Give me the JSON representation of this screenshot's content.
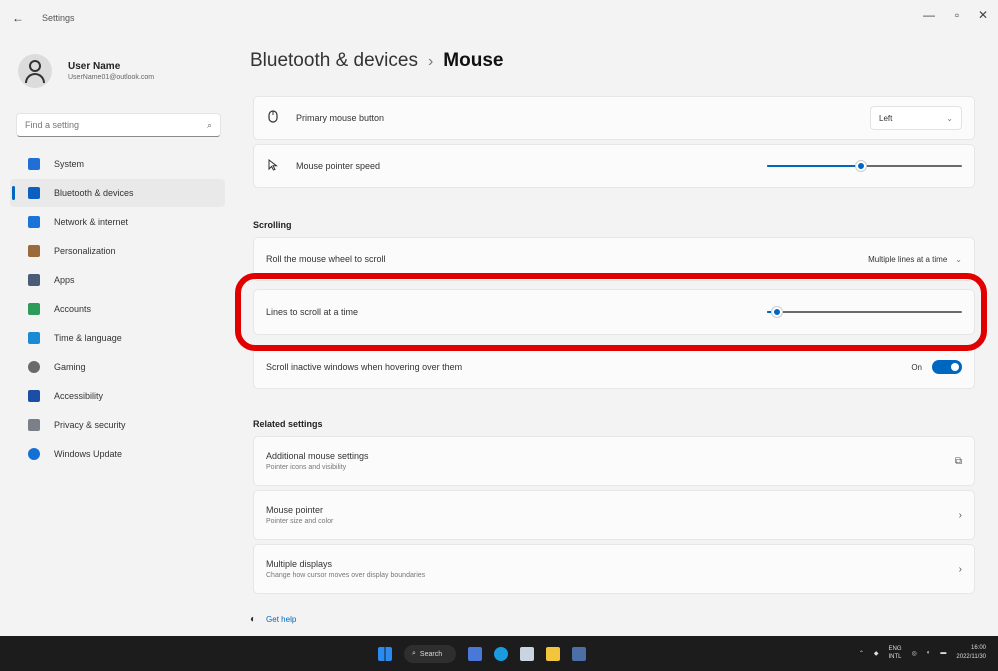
{
  "window": {
    "back_glyph": "←",
    "title": "Settings",
    "minimize_glyph": "—",
    "maximize_glyph": "▫",
    "close_glyph": "✕"
  },
  "user": {
    "name": "User Name",
    "email": "UserName01@outlook.com"
  },
  "search": {
    "placeholder": "Find a setting",
    "icon": "search-icon"
  },
  "nav": [
    {
      "label": "System",
      "icon": "system-icon",
      "color": "#1f6fd6",
      "active": false
    },
    {
      "label": "Bluetooth & devices",
      "icon": "bluetooth-icon",
      "color": "#0a5fc0",
      "active": true
    },
    {
      "label": "Network & internet",
      "icon": "network-icon",
      "color": "#1a73d9",
      "active": false
    },
    {
      "label": "Personalization",
      "icon": "brush-icon",
      "color": "#9a6a3a",
      "active": false
    },
    {
      "label": "Apps",
      "icon": "apps-icon",
      "color": "#4a5c78",
      "active": false
    },
    {
      "label": "Accounts",
      "icon": "accounts-icon",
      "color": "#2d9c5a",
      "active": false
    },
    {
      "label": "Time & language",
      "icon": "time-language-icon",
      "color": "#1a8ad4",
      "active": false
    },
    {
      "label": "Gaming",
      "icon": "gaming-icon",
      "color": "#6a6a6a",
      "active": false
    },
    {
      "label": "Accessibility",
      "icon": "accessibility-icon",
      "color": "#1b4fa6",
      "active": false
    },
    {
      "label": "Privacy & security",
      "icon": "shield-icon",
      "color": "#7a7f88",
      "active": false
    },
    {
      "label": "Windows Update",
      "icon": "windows-update-icon",
      "color": "#1570d6",
      "active": false
    }
  ],
  "breadcrumb": {
    "parent": "Bluetooth & devices",
    "separator": "›",
    "current": "Mouse"
  },
  "settings": {
    "primary_button": {
      "label": "Primary mouse button",
      "value": "Left",
      "icon": "mouse-icon"
    },
    "pointer_speed": {
      "label": "Mouse pointer speed",
      "icon": "pointer-icon",
      "value_fraction": 0.48
    },
    "scrolling_title": "Scrolling",
    "roll_wheel": {
      "label": "Roll the mouse wheel to scroll",
      "value": "Multiple lines at a time"
    },
    "lines_to_scroll": {
      "label": "Lines to scroll at a time",
      "value_fraction": 0.05
    },
    "scroll_inactive": {
      "label": "Scroll inactive windows when hovering over them",
      "state": "On"
    },
    "related_title": "Related settings",
    "additional": {
      "label": "Additional mouse settings",
      "sublabel": "Pointer icons and visibility",
      "icon": "external-link-icon"
    },
    "mouse_pointer": {
      "label": "Mouse pointer",
      "sublabel": "Pointer size and color",
      "icon": "chevron-right-icon"
    },
    "multiple_displays": {
      "label": "Multiple displays",
      "sublabel": "Change how cursor moves over display boundaries",
      "icon": "chevron-right-icon"
    }
  },
  "help": {
    "label": "Get help",
    "icon": "help-icon"
  },
  "taskbar": {
    "search_label": "Search",
    "language": "ENG",
    "region": "INTL",
    "time": "16:00",
    "date": "2022/11/30"
  },
  "annotation": {
    "highlight_color": "#e00000"
  }
}
